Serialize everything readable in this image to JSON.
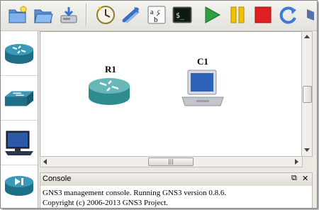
{
  "toolbar": {
    "buttons": [
      {
        "name": "new-project-button",
        "icon": "new-folder-icon"
      },
      {
        "name": "open-project-button",
        "icon": "open-folder-icon"
      },
      {
        "name": "save-project-button",
        "icon": "save-icon"
      },
      {
        "name": "snapshot-button",
        "icon": "clock-icon"
      },
      {
        "name": "add-link-button",
        "icon": "link-icon"
      },
      {
        "name": "add-note-button",
        "icon": "abc-note-icon"
      },
      {
        "name": "console-connect-button",
        "icon": "terminal-icon"
      },
      {
        "name": "start-all-button",
        "icon": "play-icon"
      },
      {
        "name": "suspend-all-button",
        "icon": "pause-icon"
      },
      {
        "name": "stop-all-button",
        "icon": "stop-icon"
      },
      {
        "name": "reload-all-button",
        "icon": "reload-icon"
      }
    ],
    "terminal_glyph": "$_",
    "note_glyph_a": "a",
    "note_glyph_b": "b",
    "note_glyph_c": "c"
  },
  "palette": {
    "devices": [
      {
        "name": "router-device",
        "icon": "router-icon"
      },
      {
        "name": "switch-device",
        "icon": "switch-icon"
      },
      {
        "name": "host-device",
        "icon": "computer-icon"
      },
      {
        "name": "cloud-device",
        "icon": "forward-router-icon"
      }
    ]
  },
  "canvas": {
    "nodes": [
      {
        "label": "R1",
        "type": "router"
      },
      {
        "label": "C1",
        "type": "host"
      }
    ]
  },
  "hscrollbar": {
    "grip": "|||"
  },
  "console": {
    "title": "Console",
    "float_glyph": "⧉",
    "close_glyph": "✕",
    "lines": [
      "GNS3 management console. Running GNS3 version 0.8.6.",
      "Copyright (c) 2006-2013 GNS3 Project."
    ]
  },
  "colors": {
    "router": "#2f8c8c",
    "play": "#2ea043",
    "pause": "#f2c200",
    "stop": "#e02020"
  }
}
